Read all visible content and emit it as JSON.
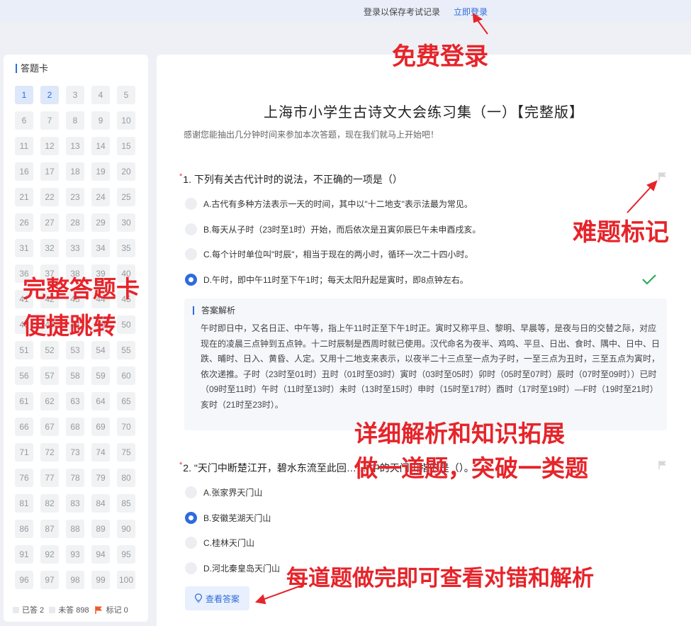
{
  "topbar": {
    "message": "登录以保存考试记录",
    "login_link": "立即登录"
  },
  "answer_card": {
    "title": "答题卡",
    "numbers": [
      "1",
      "2",
      "3",
      "4",
      "5",
      "6",
      "7",
      "8",
      "9",
      "10",
      "11",
      "12",
      "13",
      "14",
      "15",
      "16",
      "17",
      "18",
      "19",
      "20",
      "21",
      "22",
      "23",
      "24",
      "25",
      "26",
      "27",
      "28",
      "29",
      "30",
      "31",
      "32",
      "33",
      "34",
      "35",
      "36",
      "37",
      "38",
      "39",
      "40",
      "41",
      "42",
      "43",
      "44",
      "45",
      "46",
      "47",
      "48",
      "49",
      "50",
      "51",
      "52",
      "53",
      "54",
      "55",
      "56",
      "57",
      "58",
      "59",
      "60",
      "61",
      "62",
      "63",
      "64",
      "65",
      "66",
      "67",
      "68",
      "69",
      "70",
      "71",
      "72",
      "73",
      "74",
      "75",
      "76",
      "77",
      "78",
      "79",
      "80",
      "81",
      "82",
      "83",
      "84",
      "85",
      "86",
      "87",
      "88",
      "89",
      "90",
      "91",
      "92",
      "93",
      "94",
      "95",
      "96",
      "97",
      "98",
      "99",
      "100"
    ],
    "answered_numbers": [
      "1",
      "2"
    ],
    "legend": {
      "answered": "已答 2",
      "unanswered": "未答 898",
      "flagged": "标记 0"
    },
    "flag_color": "#f05a2a"
  },
  "exam": {
    "title": "上海市小学生古诗文大会练习集（一）【完整版】",
    "subtitle": "感谢您能抽出几分钟时间来参加本次答题，现在我们就马上开始吧！",
    "q1": {
      "number": "1.",
      "text": "下列有关古代计时的说法，不正确的一项是（）",
      "options": [
        "A.古代有多种方法表示一天的时间，其中以\"十二地支\"表示法最为常见。",
        "B.每天从子时（23时至1时）开始，而后依次是丑寅卯辰巳午未申酉戌亥。",
        "C.每个计时单位叫\"时辰\"，相当于现在的两小时，循环一次二十四小时。",
        "D.午时，即中午11时至下午1时；每天太阳升起是寅时，即8点钟左右。"
      ],
      "selected": "D",
      "analysis_title": "答案解析",
      "analysis": "午时即日中，又名日正、中午等，指上午11时正至下午1时正。寅时又称平旦、黎明、早晨等，是夜与日的交替之际，对应现在的凌晨三点钟到五点钟。十二时辰制是西周时就已使用。汉代命名为夜半、鸡鸣、平旦、日出、食时、隅中、日中、日跌、晡时、日入、黄昏、人定。又用十二地支来表示，以夜半二十三点至一点为子时，一至三点为丑时，三至五点为寅时，依次递推。子时（23时至01时）丑时（01时至03时）寅时（03时至05时）卯时（05时至07时）辰时（07时至09时））已时（09时至11时）午时（11时至13时）未时（13时至15时）申时（15时至17时）酉时（17时至19时）—F时（19时至21时）亥时（21时至23时）。"
    },
    "q2": {
      "number": "2.",
      "text": "\"天门中断楚江开，碧水东流至此回……\"中的天门山指的是（）。",
      "options": [
        "A.张家界天门山",
        "B.安徽芜湖天门山",
        "C.桂林天门山",
        "D.河北秦皇岛天门山"
      ],
      "selected": "B",
      "view_answer": "查看答案"
    },
    "colors": {
      "accent": "#2f6bdc",
      "required_star": "#ee3333",
      "correct": "#2eaa5a"
    }
  },
  "annotations": {
    "login": "免费登录",
    "flag": "难题标记",
    "card_line1": "完整答题卡",
    "card_line2": "便捷跳转",
    "analysis_line1": "详细解析和知识拓展",
    "analysis_line2": "做一道题，突破一类题",
    "check": "每道题做完即可查看对错和解析",
    "color": "#e6242a"
  }
}
